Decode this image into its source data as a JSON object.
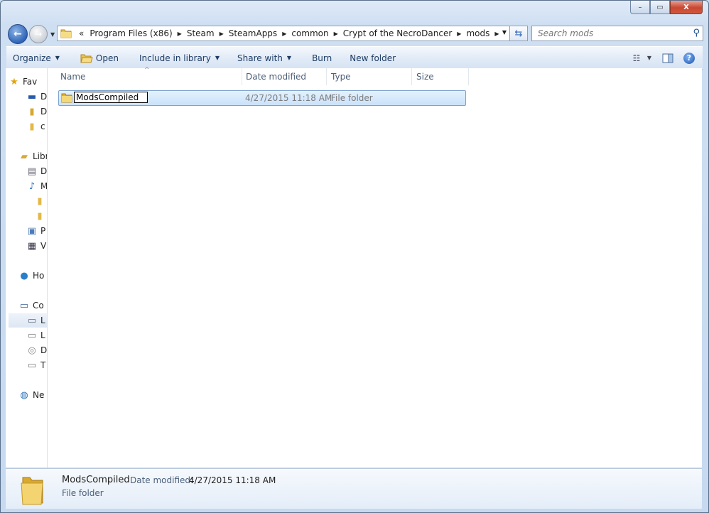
{
  "window": {
    "caption_buttons": {
      "minimize": "–",
      "maximize": "▭",
      "close": "X"
    }
  },
  "address_bar": {
    "overflow": "«",
    "crumbs": [
      "Program Files (x86)",
      "Steam",
      "SteamApps",
      "common",
      "Crypt of the NecroDancer",
      "mods"
    ]
  },
  "search": {
    "placeholder": "Search mods"
  },
  "toolbar": {
    "organize": "Organize",
    "open": "Open",
    "include_in_library": "Include in library",
    "share_with": "Share with",
    "burn": "Burn",
    "new_folder": "New folder"
  },
  "nav_pane": {
    "items": [
      {
        "label": "Fav",
        "icon": "star-icon"
      },
      {
        "label": "D",
        "icon": "desktop-icon"
      },
      {
        "label": "D",
        "icon": "downloads-icon"
      },
      {
        "label": "c",
        "icon": "folder-icon"
      },
      {
        "label": "Libr",
        "icon": "libraries-icon"
      },
      {
        "label": "D",
        "icon": "documents-icon"
      },
      {
        "label": "M",
        "icon": "music-icon"
      },
      {
        "label": "",
        "icon": "folder-icon"
      },
      {
        "label": "",
        "icon": "folder-icon"
      },
      {
        "label": "P",
        "icon": "pictures-icon"
      },
      {
        "label": "V",
        "icon": "videos-icon"
      },
      {
        "label": "Ho",
        "icon": "homegroup-icon"
      },
      {
        "label": "Co",
        "icon": "computer-icon"
      },
      {
        "label": "L",
        "icon": "local-disk-icon"
      },
      {
        "label": "L",
        "icon": "drive-icon"
      },
      {
        "label": "D",
        "icon": "dvd-drive-icon"
      },
      {
        "label": "T",
        "icon": "drive-icon"
      },
      {
        "label": "Ne",
        "icon": "network-icon"
      }
    ]
  },
  "columns": {
    "name": "Name",
    "date_modified": "Date modified",
    "type": "Type",
    "size": "Size"
  },
  "files": [
    {
      "name": "ModsCompiled",
      "date_modified": "4/27/2015 11:18 AM",
      "type": "File folder",
      "size": ""
    }
  ],
  "details": {
    "name": "ModsCompiled",
    "date_label": "Date modified:",
    "date_value": "4/27/2015 11:18 AM",
    "type": "File folder"
  }
}
